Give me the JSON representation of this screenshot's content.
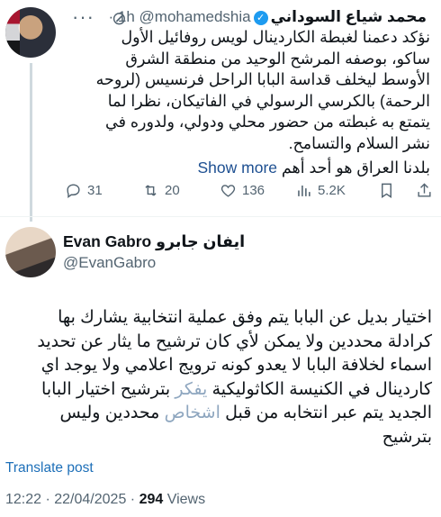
{
  "tweet1": {
    "display_name": "محمد شياع السوداني",
    "handle": "@mohamedshia",
    "time": "· 1h",
    "text": "نؤكد دعمنا لغبطة الكاردينال لويس روفائيل الأول ساكو، بوصفه المرشح الوحيد من منطقة الشرق الأوسط ليخلف قداسة البابا الراحل فرنسيس (لروحه الرحمة) بالكرسي الرسولي في الفاتيكان، نظرا لما يتمتع به غبطته من حضور محلي ودولي، ولدوره في نشر السلام والتسامح.",
    "text_line2": "بلدنا العراق هو أحد أهم",
    "show_more": "Show more",
    "counts": {
      "replies": "31",
      "reposts": "20",
      "likes": "136",
      "views": "5.2K"
    }
  },
  "tweet2": {
    "display_name": "Evan Gabro ايفان جابرو",
    "handle": "@EvanGabro",
    "text_part1": "اختيار بديل عن البابا يتم وفق عملية انتخابية يشارك بها كرادلة محددين ولا يمكن لأي كان ترشيح ما يثار عن تحديد اسماء لخلافة البابا لا يعدو كونه ترويج اعلامي ولا يوجد اي كاردينال في الكنيسة الكاثوليكية",
    "text_highlight1": "يفكر",
    "text_part2": "بترشيح اختيار البابا الجديد يتم عبر انتخابه من قبل",
    "text_highlight2": "اشخاص",
    "text_part3": "محددين وليس بترشيح",
    "translate": "Translate post",
    "timestamp": "12:22 · 22/04/2025 ·",
    "views_count": "294",
    "views_label": "Views"
  },
  "icons": [
    "more-icon",
    "grok-icon",
    "verified-icon",
    "reply-icon",
    "repost-icon",
    "like-icon",
    "views-icon",
    "bookmark-icon",
    "share-icon"
  ],
  "colors": {
    "link": "#1d9bf0",
    "muted": "#536471",
    "text": "#0f1419"
  }
}
